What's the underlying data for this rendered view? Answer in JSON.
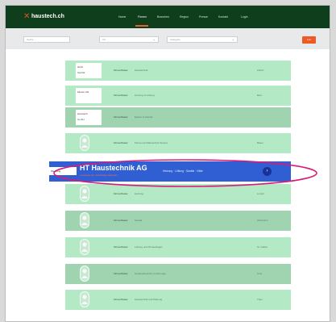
{
  "header": {
    "brand": "haustech.ch",
    "nav": [
      "Home",
      "Firmen",
      "Branchen",
      "Region",
      "Presse",
      "Kontakt",
      "Login"
    ],
    "active_nav": 1
  },
  "filters": {
    "keyword_placeholder": "Suche",
    "region_value": "Ort",
    "category_value": "Kategorie",
    "search_label": "Los"
  },
  "ad": {
    "left_label": "Werbung",
    "title": "HT Haustechnik AG",
    "tagline": "Lösungen für nachhaltige Gebäude",
    "text": "Heizung · Lüftung · Sanitär · Kälte",
    "button_icon": "arrow-right-icon"
  },
  "rows": [
    {
      "name": "Firma Muster",
      "desc": "Haustechnik",
      "meta": "Zürich",
      "thumb": "logo",
      "logo_a": "Grüß",
      "logo_b": "Sanitär"
    },
    {
      "name": "Firma Muster",
      "desc": "Heizung & Lüftung",
      "meta": "Bern",
      "thumb": "logo",
      "logo_a": "Muster AG",
      "logo_b": ""
    },
    {
      "name": "Firma Muster",
      "desc": "Elektro & Sanitär",
      "meta": "",
      "thumb": "logo",
      "logo_a": "Haustech",
      "logo_b": "GmbH"
    },
    {
      "name": "Firma Muster",
      "desc": "Klima und Kältetechnik Service",
      "meta": "Basel",
      "thumb": "avatar"
    },
    {
      "name": "Firma Muster",
      "desc": "Heizung",
      "meta": "Luzern",
      "thumb": "avatar"
    },
    {
      "name": "Firma Muster",
      "desc": "Sanitär",
      "meta": "Winterthur",
      "thumb": "avatar"
    },
    {
      "name": "Firma Muster",
      "desc": "Lüftung und Klimaanlagen",
      "meta": "St. Gallen",
      "thumb": "avatar"
    },
    {
      "name": "Firma Muster",
      "desc": "Gebäudetechnik und Energie",
      "meta": "Chur",
      "thumb": "avatar"
    },
    {
      "name": "Firma Muster",
      "desc": "Haustechnik und Planung",
      "meta": "Thun",
      "thumb": "avatar"
    }
  ],
  "colors": {
    "header": "#0f3e1d",
    "accent": "#ee5a24",
    "ad": "#2f5fd3",
    "row_light": "#b3e9c4",
    "row_dark": "#a0d3b0"
  }
}
